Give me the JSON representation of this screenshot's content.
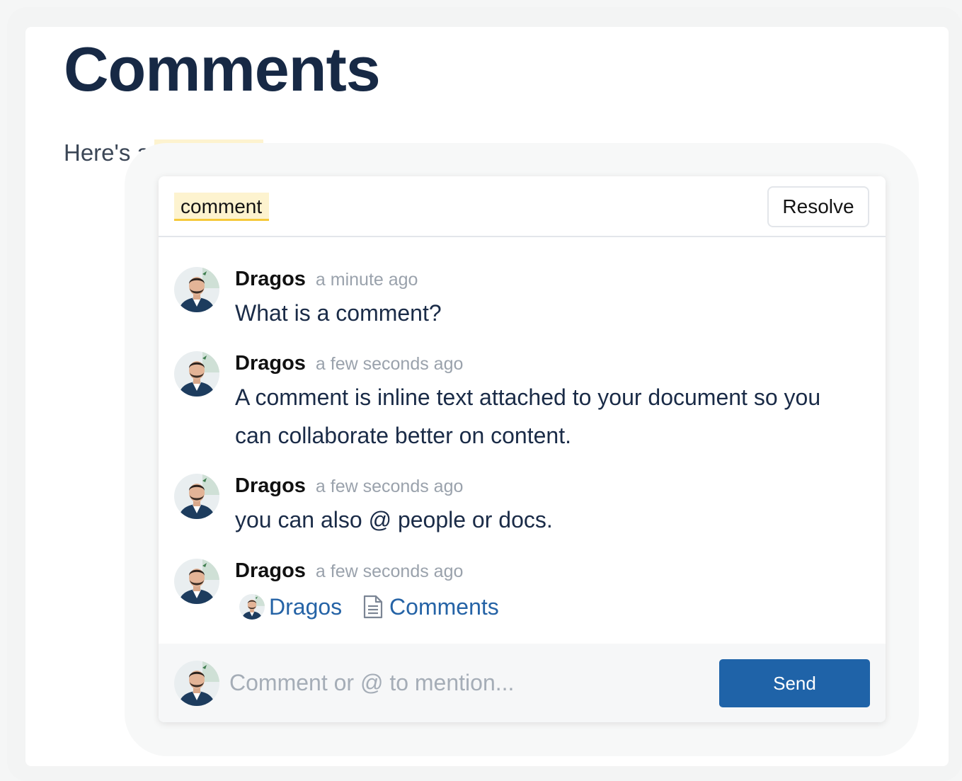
{
  "page": {
    "title": "Comments"
  },
  "paragraph": {
    "prefix": "Here's a",
    "highlight": "comment",
    "suffix": "."
  },
  "thread": {
    "quote": "comment",
    "resolve_label": "Resolve",
    "comments": [
      {
        "author": "Dragos",
        "time": "a minute ago",
        "text": "What is a comment?"
      },
      {
        "author": "Dragos",
        "time": "a few seconds ago",
        "text": "A comment is inline text attached to your document so you can collaborate better on content."
      },
      {
        "author": "Dragos",
        "time": "a few seconds ago",
        "text": "you can also @ people or docs."
      },
      {
        "author": "Dragos",
        "time": "a few seconds ago",
        "mentions": {
          "user": "Dragos",
          "doc": "Comments"
        }
      }
    ],
    "composer": {
      "placeholder": "Comment or @ to mention...",
      "send_label": "Send"
    }
  },
  "colors": {
    "accent": "#1f63a8",
    "highlight_bg": "#fdf3cf",
    "highlight_border": "#f5c93b",
    "mention_link": "#2563a6"
  },
  "icons": {
    "avatar": "user-avatar",
    "doc": "document-icon"
  }
}
